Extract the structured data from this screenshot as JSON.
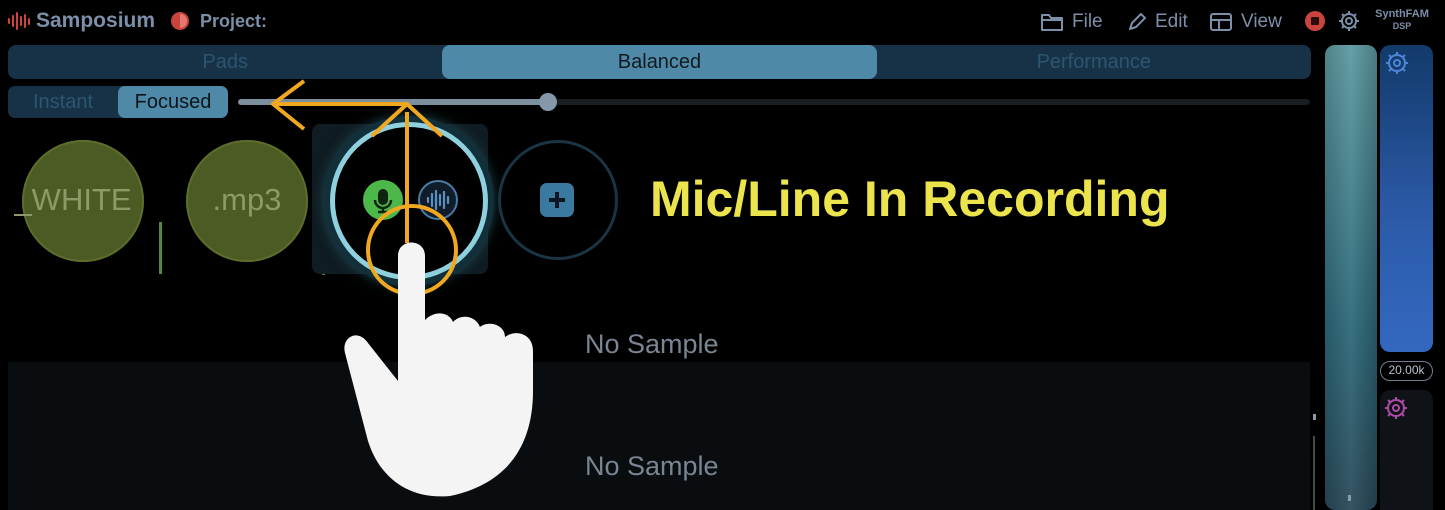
{
  "header": {
    "app_name": "Samposium",
    "project_label": "Project:",
    "menu": {
      "file": "File",
      "edit": "Edit",
      "view": "View"
    },
    "brand_top": "SynthFAM",
    "brand_bottom": "DSP"
  },
  "modes": {
    "tabs": [
      "Pads",
      "Balanced",
      "Performance"
    ],
    "selected": "Balanced"
  },
  "latency": {
    "options": [
      "Instant",
      "Focused"
    ],
    "selected": "Focused"
  },
  "slider": {
    "value_fraction": 0.29
  },
  "pads": [
    {
      "label": "_WHITE"
    },
    {
      "label": ".mp3"
    },
    {
      "label": "",
      "buttons": [
        "mic-icon",
        "waveform-icon"
      ]
    },
    {
      "label": "",
      "buttons": [
        "plus-icon"
      ]
    }
  ],
  "annotation": "Mic/Line In Recording",
  "lanes": [
    "No Sample",
    "No Sample"
  ],
  "right_panel": {
    "freq_readout": "20.00k"
  },
  "colors": {
    "accent": "#4e8aa8",
    "annotation": "#ece44c",
    "record": "#c8443c",
    "mic_button": "#4cb84a",
    "arrow": "#f0a820"
  }
}
